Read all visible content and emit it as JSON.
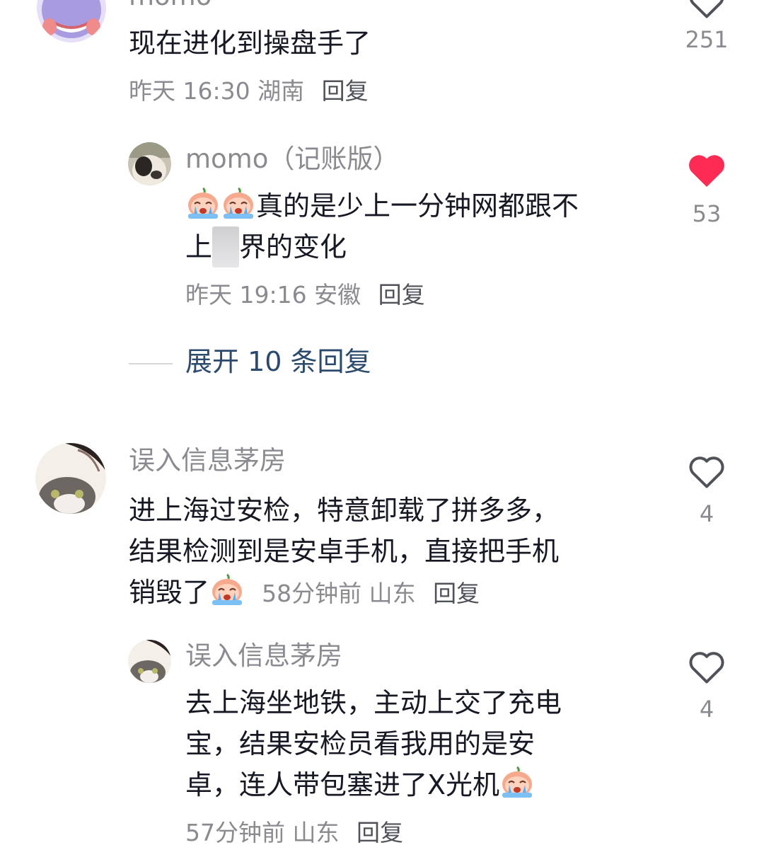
{
  "comments": [
    {
      "username": "momo",
      "text": "现在进化到操盘手了",
      "time": "昨天 16:30",
      "location": "湖南",
      "reply_label": "回复",
      "like_count": "251",
      "liked": false
    },
    {
      "username": "momo（记账版）",
      "text_line1": "真的是少上一分钟网都跟不",
      "text_line2_a": "上",
      "text_line2_blurred": "世",
      "text_line2_b": "界的变化",
      "time": "昨天 19:16",
      "location": "安徽",
      "reply_label": "回复",
      "like_count": "53",
      "liked": true,
      "emoji": "crying-emoji"
    },
    {
      "username": "误入信息茅房",
      "text_line1": "进上海过安检，特意卸载了拼多多，",
      "text_line2": "结果检测到是安卓手机，直接把手机",
      "text_line3": "销毁了",
      "time": "58分钟前",
      "location": "山东",
      "reply_label": "回复",
      "like_count": "4",
      "liked": false,
      "emoji": "crying-emoji"
    },
    {
      "username": "误入信息茅房",
      "text_line1": "去上海坐地铁，主动上交了充电",
      "text_line2": "宝，结果安检员看我用的是安",
      "text_line3": "卓，连人带包塞进了X光机",
      "time": "57分钟前",
      "location": "山东",
      "reply_label": "回复",
      "like_count": "4",
      "liked": false,
      "emoji": "crying-emoji"
    }
  ],
  "expand_replies_label": "展开 10 条回复",
  "colors": {
    "like_active": "#fe2c55",
    "link": "#2b4a6d",
    "muted": "#8a8b91"
  }
}
